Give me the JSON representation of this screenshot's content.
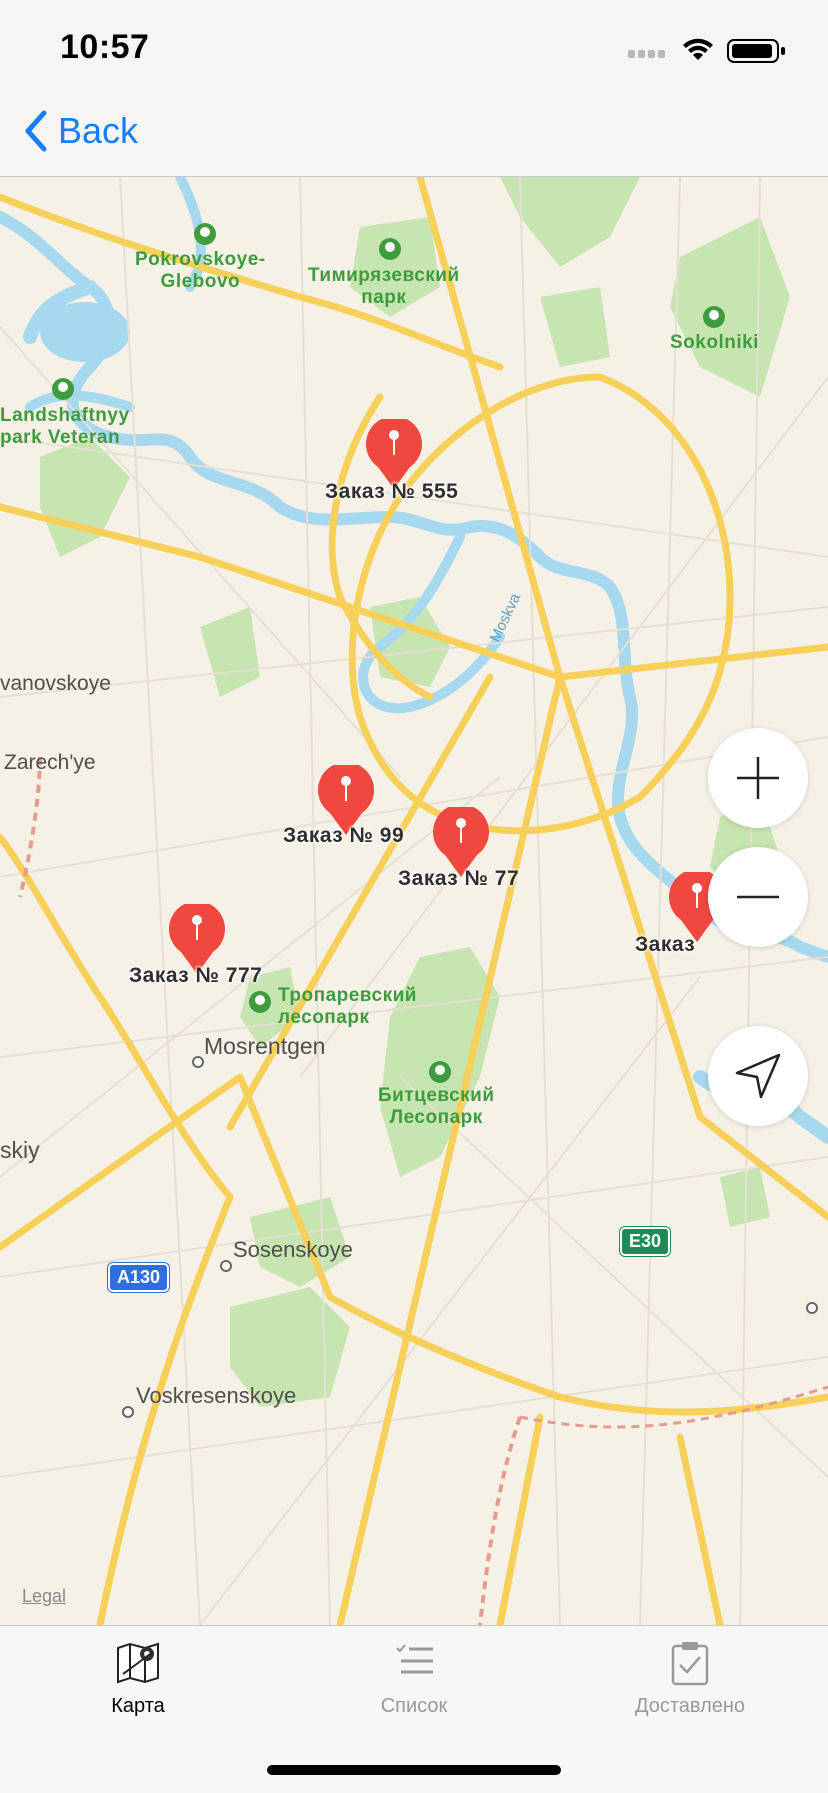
{
  "status_bar": {
    "time": "10:57"
  },
  "nav": {
    "back_label": "Back"
  },
  "map": {
    "places": [
      {
        "name": "Pokrovskoye-\nGlebovo",
        "kind": "park"
      },
      {
        "name": "Тимирязевский\nпарк",
        "kind": "park"
      },
      {
        "name": "Sokolniki",
        "kind": "park"
      },
      {
        "name": "Landshaftnyy\npark Veteran",
        "kind": "park"
      },
      {
        "name": "Тропаревский\nлесопарк",
        "kind": "park"
      },
      {
        "name": "Битцевский\nЛесопарк",
        "kind": "park"
      },
      {
        "name": "vanovskoye",
        "kind": "town"
      },
      {
        "name": "Zarech'ye",
        "kind": "town"
      },
      {
        "name": "Mosrentgen",
        "kind": "town"
      },
      {
        "name": "skiy",
        "kind": "town"
      },
      {
        "name": "Sosenskoye",
        "kind": "town"
      },
      {
        "name": "Voskresenskoye",
        "kind": "town"
      },
      {
        "name": "Moskva",
        "kind": "river"
      }
    ],
    "pins": [
      {
        "label": "Заказ № 555"
      },
      {
        "label": "Заказ № 99"
      },
      {
        "label": "Заказ № 77"
      },
      {
        "label": "Заказ № 777"
      },
      {
        "label": "Заказ "
      }
    ],
    "shields": [
      "A130",
      "E30"
    ],
    "legal": "Legal"
  },
  "tabs": [
    {
      "label": "Карта",
      "active": true
    },
    {
      "label": "Список",
      "active": false
    },
    {
      "label": "Доставлено",
      "active": false
    }
  ],
  "colors": {
    "accent": "#157efb",
    "pin": "#f0483e",
    "road": "#f7d05a",
    "water": "#a6d8f0",
    "park": "#c7e5b0"
  }
}
